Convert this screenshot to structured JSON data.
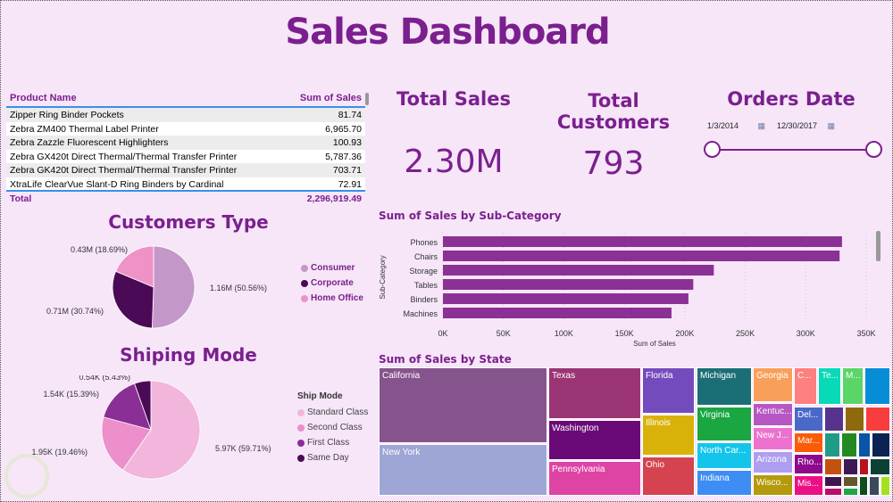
{
  "title": "Sales Dashboard",
  "table": {
    "headers": [
      "Product Name",
      "Sum of Sales"
    ],
    "rows": [
      [
        "Zipper Ring Binder Pockets",
        "81.74"
      ],
      [
        "Zebra ZM400 Thermal Label Printer",
        "6,965.70"
      ],
      [
        "Zebra Zazzle Fluorescent Highlighters",
        "100.93"
      ],
      [
        "Zebra GX420t Direct Thermal/Thermal Transfer Printer",
        "5,787.36"
      ],
      [
        "Zebra GK420t Direct Thermal/Thermal Transfer Printer",
        "703.71"
      ],
      [
        "XtraLife ClearVue Slant-D Ring Binders by Cardinal",
        "72.91"
      ]
    ],
    "total_label": "Total",
    "total_value": "2,296,919.49"
  },
  "kpis": {
    "total_sales": {
      "label": "Total Sales",
      "value": "2.30M"
    },
    "total_customers": {
      "label": "Total Customers",
      "value": "793"
    }
  },
  "orders_date": {
    "label": "Orders Date",
    "start": "1/3/2014",
    "end": "12/30/2017",
    "icon": "calendar-icon",
    "range_fraction": [
      0,
      1
    ]
  },
  "customers_type": {
    "title": "Customers Type",
    "slices": [
      {
        "name": "Consumer",
        "label": "1.16M (50.56%)",
        "percent": 50.56,
        "color": "#c497c9"
      },
      {
        "name": "Corporate",
        "label": "0.71M (30.74%)",
        "percent": 30.74,
        "color": "#4b0a55"
      },
      {
        "name": "Home Office",
        "label": "0.43M (18.69%)",
        "percent": 18.69,
        "color": "#ee92c8"
      }
    ]
  },
  "ship_mode": {
    "title": "Shiping Mode",
    "legend_title": "Ship Mode",
    "slices": [
      {
        "name": "Standard Class",
        "label": "5.97K (59.71%)",
        "percent": 59.71,
        "color": "#f2b5dc"
      },
      {
        "name": "Second Class",
        "label": "1.95K (19.46%)",
        "percent": 19.46,
        "color": "#ec8fcb"
      },
      {
        "name": "First Class",
        "label": "1.54K (15.39%)",
        "percent": 15.39,
        "color": "#8a2f95"
      },
      {
        "name": "Same Day",
        "label": "0.54K (5.43%)",
        "percent": 5.43,
        "color": "#4b0a55"
      }
    ]
  },
  "chart_data": {
    "type": "bar",
    "orientation": "horizontal",
    "title": "Sum of Sales by Sub-Category",
    "xlabel": "Sum of Sales",
    "ylabel": "Sub-Category",
    "categories": [
      "Phones",
      "Chairs",
      "Storage",
      "Tables",
      "Binders",
      "Machines"
    ],
    "values": [
      330000,
      328000,
      224000,
      207000,
      203000,
      189000
    ],
    "xlim": [
      0,
      350000
    ],
    "xticks": [
      "0K",
      "50K",
      "100K",
      "150K",
      "200K",
      "250K",
      "300K",
      "350K"
    ],
    "color": "#8b3195",
    "grid": true
  },
  "treemap": {
    "title": "Sum of Sales by State",
    "cells": [
      {
        "name": "California",
        "color": "#86548d"
      },
      {
        "name": "New York",
        "color": "#9ea6d6"
      },
      {
        "name": "Texas",
        "color": "#9b3474"
      },
      {
        "name": "Washington",
        "color": "#6a0a77"
      },
      {
        "name": "Pennsylvania",
        "color": "#de44a3"
      },
      {
        "name": "Florida",
        "color": "#744bbd"
      },
      {
        "name": "Illinois",
        "color": "#d8b208"
      },
      {
        "name": "Ohio",
        "color": "#d4434f"
      },
      {
        "name": "Michigan",
        "color": "#1c6e76"
      },
      {
        "name": "Virginia",
        "color": "#1aa641"
      },
      {
        "name": "North Car...",
        "color": "#14c5eb"
      },
      {
        "name": "Indiana",
        "color": "#3e8df5"
      },
      {
        "name": "Georgia",
        "color": "#f8a05a"
      },
      {
        "name": "Kentuc...",
        "color": "#b657c4"
      },
      {
        "name": "New J...",
        "color": "#ec72cd"
      },
      {
        "name": "Arizona",
        "color": "#ad9ef0"
      },
      {
        "name": "Wisco...",
        "color": "#b49a0c"
      },
      {
        "name": "C...",
        "color": "#fd7f7f"
      },
      {
        "name": "Te...",
        "color": "#08d9b7"
      },
      {
        "name": "M...",
        "color": "#5bd468"
      },
      {
        "name": "",
        "color": "#078dd6"
      },
      {
        "name": "Del...",
        "color": "#4a68c7"
      },
      {
        "name": "Mar...",
        "color": "#fb5a06"
      },
      {
        "name": "Rho...",
        "color": "#8d0a8a"
      },
      {
        "name": "Mis...",
        "color": "#ec0f86"
      },
      {
        "name": "",
        "color": "#56338c"
      },
      {
        "name": "",
        "color": "#8e6a0c"
      },
      {
        "name": "",
        "color": "#f73d3d"
      },
      {
        "name": "",
        "color": "#219a86"
      },
      {
        "name": "",
        "color": "#238a21"
      },
      {
        "name": "",
        "color": "#0a55a5"
      },
      {
        "name": "",
        "color": "#0b2352"
      },
      {
        "name": "",
        "color": "#c4510f"
      },
      {
        "name": "",
        "color": "#3a1a55"
      },
      {
        "name": "",
        "color": "#b8141e"
      },
      {
        "name": "",
        "color": "#0d4035"
      },
      {
        "name": "",
        "color": "#3d1650"
      },
      {
        "name": "",
        "color": "#66562a"
      },
      {
        "name": "",
        "color": "#0c4d1e"
      },
      {
        "name": "",
        "color": "#3a4a5a"
      },
      {
        "name": "",
        "color": "#b80d6c"
      },
      {
        "name": "",
        "color": "#1ea647"
      },
      {
        "name": "",
        "color": "#a2e21e"
      }
    ]
  }
}
